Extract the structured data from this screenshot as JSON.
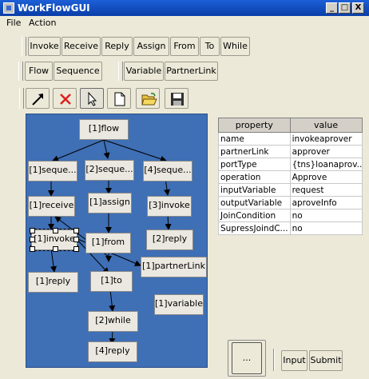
{
  "window": {
    "title": "WorkFlowGUI",
    "min": "_",
    "max": "□",
    "close": "X"
  },
  "menu": {
    "file": "File",
    "action": "Action"
  },
  "toolbar_activities": [
    "Invoke",
    "Receive",
    "Reply",
    "Assign",
    "From",
    "To",
    "While"
  ],
  "toolbar_structures": [
    "Flow",
    "Sequence"
  ],
  "toolbar_elements": [
    "Variable",
    "PartnerLink"
  ],
  "tools": [
    "arrow-link-icon",
    "delete-x-icon",
    "pointer-select-icon",
    "new-file-icon",
    "open-folder-icon",
    "save-disk-icon"
  ],
  "colors": {
    "canvas": "#3f6fb5",
    "node": "#eae8e0",
    "delete": "#e02020",
    "titlebar": "#0a3ea8"
  },
  "graph": {
    "nodes": {
      "flow": "[1]flow",
      "seq1": "[1]seque...",
      "seq2": "[2]seque...",
      "seq4": "[4]seque...",
      "receive1": "[1]receive",
      "assign1": "[1]assign",
      "invoke3": "[3]invoke",
      "invoke1": "[1]invoke",
      "from1": "[1]from",
      "reply2": "[2]reply",
      "partnerlink1": "[1]partnerLink",
      "reply1": "[1]reply",
      "to1": "[1]to",
      "variable1": "[1]variable",
      "while2": "[2]while",
      "reply4": "[4]reply"
    },
    "selected": "invoke1"
  },
  "properties": {
    "headers": [
      "property",
      "value"
    ],
    "rows": [
      [
        "name",
        "invokeaprover"
      ],
      [
        "partnerLink",
        "approver"
      ],
      [
        "portType",
        "{tns}loanaprov..."
      ],
      [
        "operation",
        "Approve"
      ],
      [
        "inputVariable",
        "request"
      ],
      [
        "outputVariable",
        "aproveInfo"
      ],
      [
        "JoinCondition",
        "no"
      ],
      [
        "SupressJoindC...",
        "no"
      ]
    ]
  },
  "bottom": {
    "more": "...",
    "input": "Input",
    "submit": "Submit"
  }
}
